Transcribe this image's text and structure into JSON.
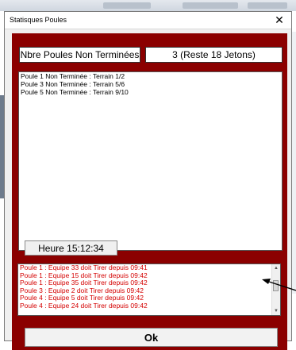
{
  "window": {
    "title": "Statisques Poules",
    "close_glyph": "✕"
  },
  "stats": {
    "label": "Nbre Poules Non Terminées",
    "value": "3 (Reste 18 Jetons)"
  },
  "poules_list": [
    "Poule 1 Non Terminée : Terrain 1/2",
    "Poule 3 Non Terminée : Terrain 5/6",
    "Poule 5 Non Terminée : Terrain 9/10"
  ],
  "heure": "Heure 15:12:34",
  "messages": [
    "Poule 1 : Equipe 33 doit Tirer depuis 09:41",
    "Poule 1 : Equipe 15 doit Tirer depuis 09:42",
    "Poule 1 : Equipe 35 doit Tirer depuis 09:42",
    "Poule 3 : Equipe 2 doit Tirer depuis 09:42",
    "Poule 4 : Equipe 5 doit Tirer depuis 09:42",
    "Poule 4 : Equipe 24 doit Tirer depuis 09:42"
  ],
  "ok_label": "Ok",
  "colors": {
    "panel": "#8b0000",
    "message_text": "#d40000"
  },
  "icons": {
    "close": "close-icon",
    "scroll_up": "scroll-up-icon",
    "scroll_down": "scroll-down-icon",
    "annotation_arrow": "arrow-icon"
  }
}
